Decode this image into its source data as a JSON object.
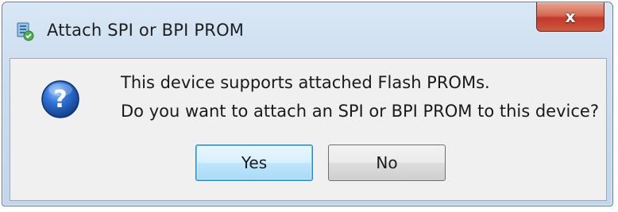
{
  "window": {
    "title": "Attach SPI or BPI PROM",
    "close_glyph": "x"
  },
  "dialog": {
    "icon": "question-icon",
    "message_line1": "This device supports attached Flash PROMs.",
    "message_line2": "Do you want to attach an SPI or BPI PROM to this device?"
  },
  "buttons": {
    "yes_label": "Yes",
    "no_label": "No"
  },
  "colors": {
    "titlebar": "#cbdcee",
    "close_button": "#c0382a",
    "content_background": "#f0f0f0",
    "default_button_border": "#3c7fb1",
    "question_icon": "#1f5fbf"
  }
}
